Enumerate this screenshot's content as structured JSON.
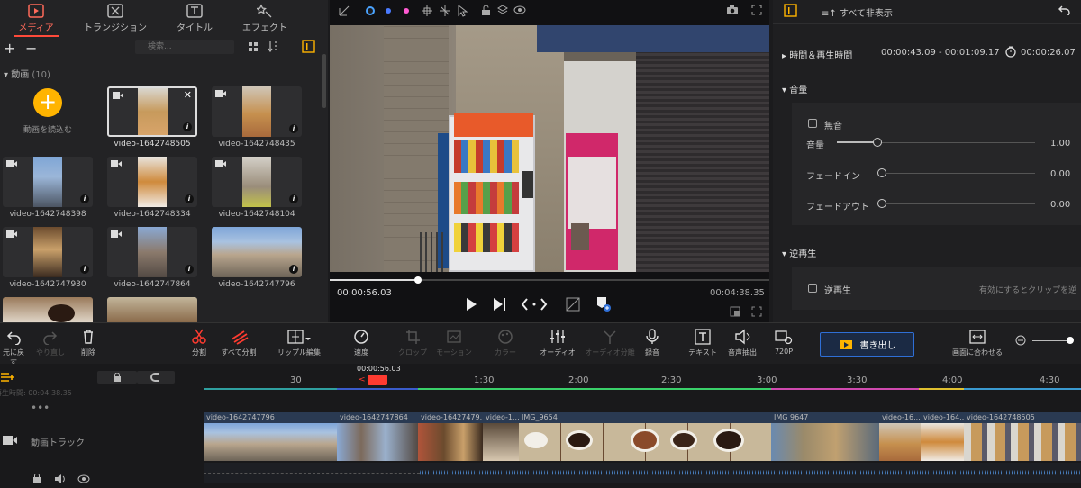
{
  "media_tabs": [
    {
      "label": "メディア",
      "active": true
    },
    {
      "label": "トランジション",
      "active": false
    },
    {
      "label": "タイトル",
      "active": false
    },
    {
      "label": "エフェクト",
      "active": false
    }
  ],
  "search": {
    "placeholder": "検索..."
  },
  "group": {
    "label": "動画",
    "count": "(10)"
  },
  "import_label": "動画を読込む",
  "media_items": [
    {
      "name": "video-1642748505",
      "selected": true
    },
    {
      "name": "video-1642748435"
    },
    {
      "name": "video-1642748398"
    },
    {
      "name": "video-1642748334"
    },
    {
      "name": "video-1642748104"
    },
    {
      "name": "video-1642747930"
    },
    {
      "name": "video-1642747864"
    },
    {
      "name": "video-1642747796"
    }
  ],
  "preview": {
    "current_time": "00:00:56.03",
    "total_time": "00:04:38.35",
    "progress": 0.2
  },
  "props": {
    "hide_all": "すべて非表示",
    "time_section": "時間＆再生時間",
    "time_range": "00:00:43.09 - 00:01:09.17",
    "duration": "00:00:26.07",
    "audio_section": "音量",
    "mute_label": "無音",
    "volume_label": "音量",
    "volume_value": "1.00",
    "fadein_label": "フェードイン",
    "fadein_value": "0.00",
    "fadeout_label": "フェードアウト",
    "fadeout_value": "0.00",
    "reverse_section": "逆再生",
    "reverse_label": "逆再生",
    "reverse_hint": "有効にするとクリップを逆"
  },
  "toolbar": {
    "undo": "元に戻す",
    "redo": "やり直し",
    "delete": "削除",
    "split": "分割",
    "split_all": "すべて分割",
    "ripple": "リップル編集",
    "speed": "速度",
    "crop": "クロップ",
    "motion": "モーション",
    "color": "カラー",
    "audio": "オーディオ",
    "audio_split": "オーディオ分離",
    "record": "録音",
    "text": "テキスト",
    "voice_extract": "音声抽出",
    "resolution": "720P",
    "export": "書き出し",
    "fit": "画面に合わせる"
  },
  "timeline": {
    "playhead_time": "00:00:56.03",
    "ticks": [
      "30",
      "1:30",
      "2:00",
      "2:30",
      "3:00",
      "3:30",
      "4:00",
      "4:30"
    ],
    "total_label": "再生時間: 00:04:38.35",
    "track_label": "動画トラック",
    "clips": [
      "video-1642747796",
      "video-1642747864",
      "video-16427479...",
      "video-1...",
      "IMG_9654",
      "IMG 9647",
      "video-16...",
      "video-164...",
      "video-1642748505"
    ]
  },
  "colors": {
    "accent": "#ff4a3a",
    "export_border": "#2f6fd6",
    "export_bg": "#1b2a44"
  }
}
